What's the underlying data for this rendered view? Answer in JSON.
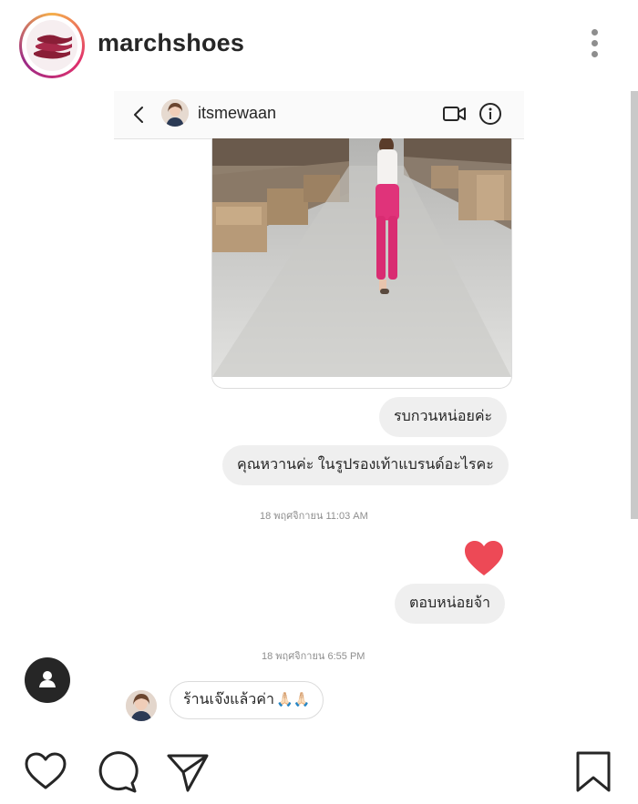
{
  "post": {
    "username": "marchshoes",
    "more_icon": "more-vertical-icon"
  },
  "dm": {
    "header": {
      "username": "itsmewaan",
      "back_icon": "chevron-left-icon",
      "video_icon": "video-call-icon",
      "info_icon": "info-icon"
    },
    "messages": [
      {
        "text": "รบกวนหน่อยค่ะ"
      },
      {
        "text": "คุณหวานค่ะ ในรูปรองเท้าแบรนด์อะไรคะ"
      }
    ],
    "timestamp_1": "18 พฤศจิกายน 11:03 AM",
    "heart_reaction": "❤",
    "reply_1": "ตอบหน่อยจ้า",
    "timestamp_2": "18 พฤศจิกายน 6:55 PM",
    "incoming_reply": "ร้านเจ๊งแล้วค่า",
    "incoming_emoji": "🙏🏻🙏🏻"
  },
  "colors": {
    "heart": "#ed4956",
    "bubble": "#efefef",
    "text": "#262626",
    "muted": "#8e8e8e",
    "pants": "#e0337a"
  },
  "actions": [
    "like-icon",
    "comment-icon",
    "share-icon",
    "save-icon"
  ]
}
